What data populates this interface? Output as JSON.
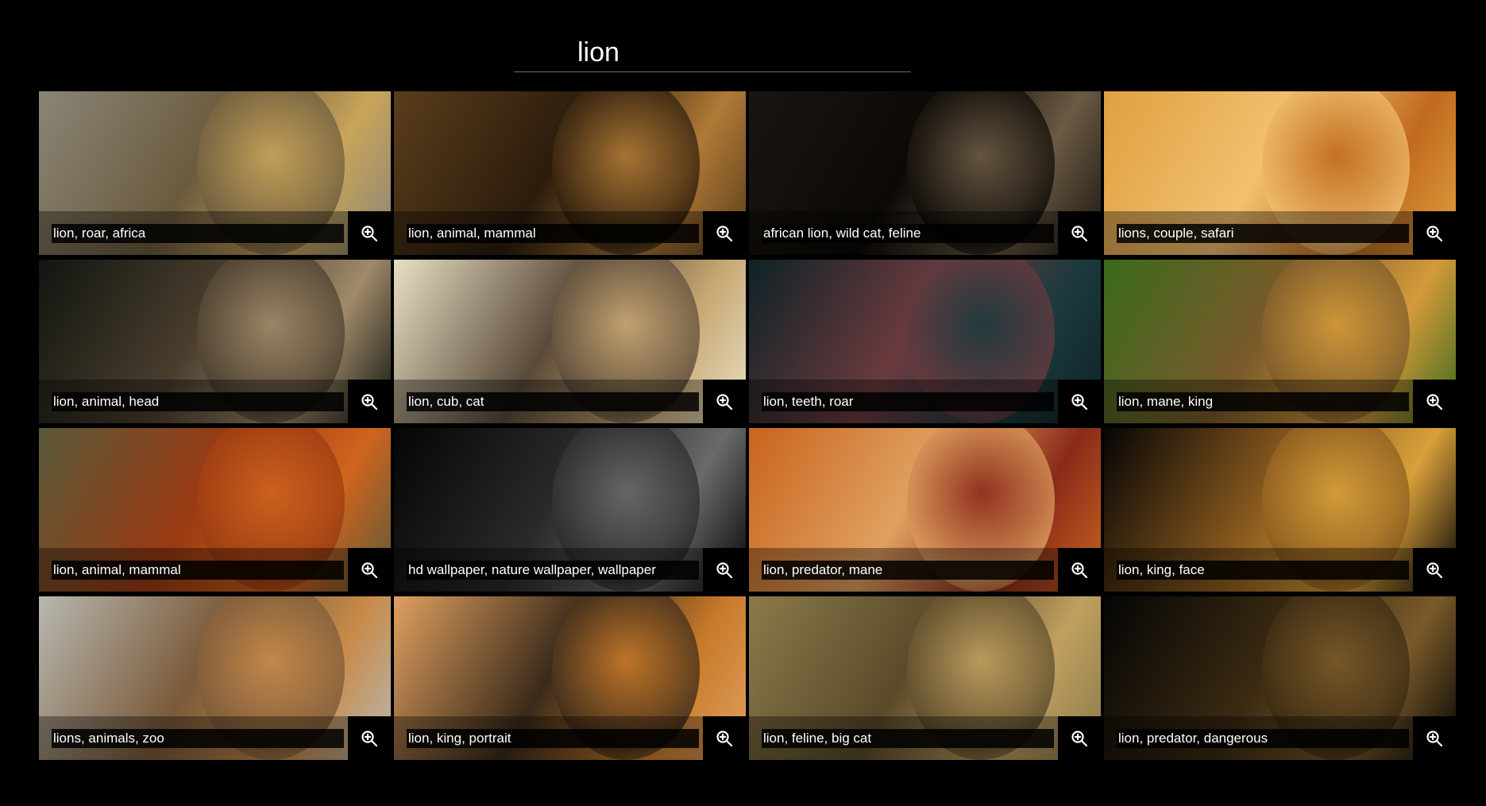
{
  "search": {
    "value": "lion",
    "placeholder": ""
  },
  "zoom_icon": "zoom-in-icon",
  "tiles": [
    {
      "caption": "lion, roar, africa",
      "palette": [
        "#8a8577",
        "#c9a45a",
        "#6b5b3e"
      ]
    },
    {
      "caption": "lion, animal, mammal",
      "palette": [
        "#5a3d1c",
        "#b07a36",
        "#2b1c0c"
      ]
    },
    {
      "caption": "african lion, wild cat, feline",
      "palette": [
        "#1a1510",
        "#6b5a44",
        "#0c0906"
      ]
    },
    {
      "caption": "lions, couple, safari",
      "palette": [
        "#e0a040",
        "#c06a1e",
        "#f2c070"
      ]
    },
    {
      "caption": "lion, animal, head",
      "palette": [
        "#111510",
        "#a08a6a",
        "#4a3e2e"
      ]
    },
    {
      "caption": "lion, cub, cat",
      "palette": [
        "#e8e0c4",
        "#c8a874",
        "#5a4a3a"
      ]
    },
    {
      "caption": "lion, teeth, roar",
      "palette": [
        "#0e2226",
        "#1c3a3e",
        "#6a3a3e"
      ]
    },
    {
      "caption": "lion, mane, king",
      "palette": [
        "#3a6a1e",
        "#d49a3a",
        "#7a5a2a"
      ]
    },
    {
      "caption": "lion, animal, mammal",
      "palette": [
        "#5a5a3a",
        "#d0641e",
        "#9a3a12"
      ]
    },
    {
      "caption": "hd wallpaper, nature wallpaper, wallpaper",
      "palette": [
        "#050505",
        "#6a6a6a",
        "#2a2a2a"
      ]
    },
    {
      "caption": "lion, predator, mane",
      "palette": [
        "#c8641e",
        "#8a2a1a",
        "#e0a060"
      ]
    },
    {
      "caption": "lion, king, face",
      "palette": [
        "#050505",
        "#d8a03a",
        "#8a5a1e"
      ]
    },
    {
      "caption": "lions, animals, zoo",
      "palette": [
        "#b8b8b0",
        "#c88a4a",
        "#7a5a3a"
      ]
    },
    {
      "caption": "lion, king, portrait",
      "palette": [
        "#e0a060",
        "#c87a2a",
        "#3a2a1a"
      ]
    },
    {
      "caption": "lion, feline, big cat",
      "palette": [
        "#8a7a4a",
        "#c0a060",
        "#5a4a2a"
      ]
    },
    {
      "caption": "lion, predator, dangerous",
      "palette": [
        "#050505",
        "#7a5a2a",
        "#3a2a12"
      ]
    }
  ]
}
